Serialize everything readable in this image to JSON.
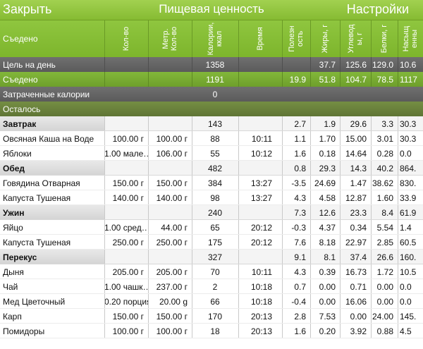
{
  "nav": {
    "left_label": "Закрыть",
    "title": "Пищевая ценность",
    "right_label": "Настройки"
  },
  "header": {
    "first": "Съедено",
    "columns": [
      "Кол-во",
      "Метр. Кол-во",
      "Калории, ккал",
      "Время",
      "Полезн ость",
      "Жиры, г",
      "Углевод ы, г",
      "Белки, г",
      "Насыщ енны"
    ]
  },
  "summary": {
    "goal": {
      "label": "Цель на день",
      "calories": "1358",
      "fat": "37.7",
      "carbs": "125.6",
      "protein": "129.0",
      "sat": "10.6"
    },
    "eaten": {
      "label": "Съедено",
      "calories": "1191",
      "health": "19.9",
      "fat": "51.8",
      "carbs": "104.7",
      "protein": "78.5",
      "sat": "1117"
    },
    "burned": {
      "label": "Затраченные калории",
      "calories": "0"
    },
    "left": {
      "label": "Осталось"
    }
  },
  "meals": [
    {
      "name": "Завтрак",
      "calories": "143",
      "health": "2.7",
      "fat": "1.9",
      "carbs": "29.6",
      "protein": "3.3",
      "sat": "30.3",
      "items": [
        {
          "name": "Овсяная Каша на Воде",
          "qty": "100.00 г",
          "mqty": "100.00 г",
          "calories": "88",
          "time": "10:11",
          "health": "1.1",
          "fat": "1.70",
          "carbs": "15.00",
          "protein": "3.01",
          "sat": "30.3"
        },
        {
          "name": "Яблоки",
          "qty": "1.00 мале…",
          "mqty": "106.00 г",
          "calories": "55",
          "time": "10:12",
          "health": "1.6",
          "fat": "0.18",
          "carbs": "14.64",
          "protein": "0.28",
          "sat": "0.0"
        }
      ]
    },
    {
      "name": "Обед",
      "calories": "482",
      "health": "0.8",
      "fat": "29.3",
      "carbs": "14.3",
      "protein": "40.2",
      "sat": "864.",
      "items": [
        {
          "name": "Говядина Отварная",
          "qty": "150.00 г",
          "mqty": "150.00 г",
          "calories": "384",
          "time": "13:27",
          "health": "-3.5",
          "fat": "24.69",
          "carbs": "1.47",
          "protein": "38.62",
          "sat": "830."
        },
        {
          "name": "Капуста Тушеная",
          "qty": "140.00 г",
          "mqty": "140.00 г",
          "calories": "98",
          "time": "13:27",
          "health": "4.3",
          "fat": "4.58",
          "carbs": "12.87",
          "protein": "1.60",
          "sat": "33.9"
        }
      ]
    },
    {
      "name": "Ужин",
      "calories": "240",
      "health": "7.3",
      "fat": "12.6",
      "carbs": "23.3",
      "protein": "8.4",
      "sat": "61.9",
      "items": [
        {
          "name": "Яйцо",
          "qty": "1.00 сред…",
          "mqty": "44.00 г",
          "calories": "65",
          "time": "20:12",
          "health": "-0.3",
          "fat": "4.37",
          "carbs": "0.34",
          "protein": "5.54",
          "sat": "1.4"
        },
        {
          "name": "Капуста Тушеная",
          "qty": "250.00 г",
          "mqty": "250.00 г",
          "calories": "175",
          "time": "20:12",
          "health": "7.6",
          "fat": "8.18",
          "carbs": "22.97",
          "protein": "2.85",
          "sat": "60.5"
        }
      ]
    },
    {
      "name": "Перекус",
      "calories": "327",
      "health": "9.1",
      "fat": "8.1",
      "carbs": "37.4",
      "protein": "26.6",
      "sat": "160.",
      "items": [
        {
          "name": "Дыня",
          "qty": "205.00 г",
          "mqty": "205.00 г",
          "calories": "70",
          "time": "10:11",
          "health": "4.3",
          "fat": "0.39",
          "carbs": "16.73",
          "protein": "1.72",
          "sat": "10.5"
        },
        {
          "name": "Чай",
          "qty": "1.00 чашк…",
          "mqty": "237.00 г",
          "calories": "2",
          "time": "10:18",
          "health": "0.7",
          "fat": "0.00",
          "carbs": "0.71",
          "protein": "0.00",
          "sat": "0.0"
        },
        {
          "name": "Мед Цветочный",
          "qty": "0.20 порция",
          "mqty": "20.00 g",
          "calories": "66",
          "time": "10:18",
          "health": "-0.4",
          "fat": "0.00",
          "carbs": "16.06",
          "protein": "0.00",
          "sat": "0.0"
        },
        {
          "name": "Карп",
          "qty": "150.00 г",
          "mqty": "150.00 г",
          "calories": "170",
          "time": "20:13",
          "health": "2.8",
          "fat": "7.53",
          "carbs": "0.00",
          "protein": "24.00",
          "sat": "145."
        },
        {
          "name": "Помидоры",
          "qty": "100.00 г",
          "mqty": "100.00 г",
          "calories": "18",
          "time": "20:13",
          "health": "1.6",
          "fat": "0.20",
          "carbs": "3.92",
          "protein": "0.88",
          "sat": "4.5"
        }
      ]
    }
  ]
}
